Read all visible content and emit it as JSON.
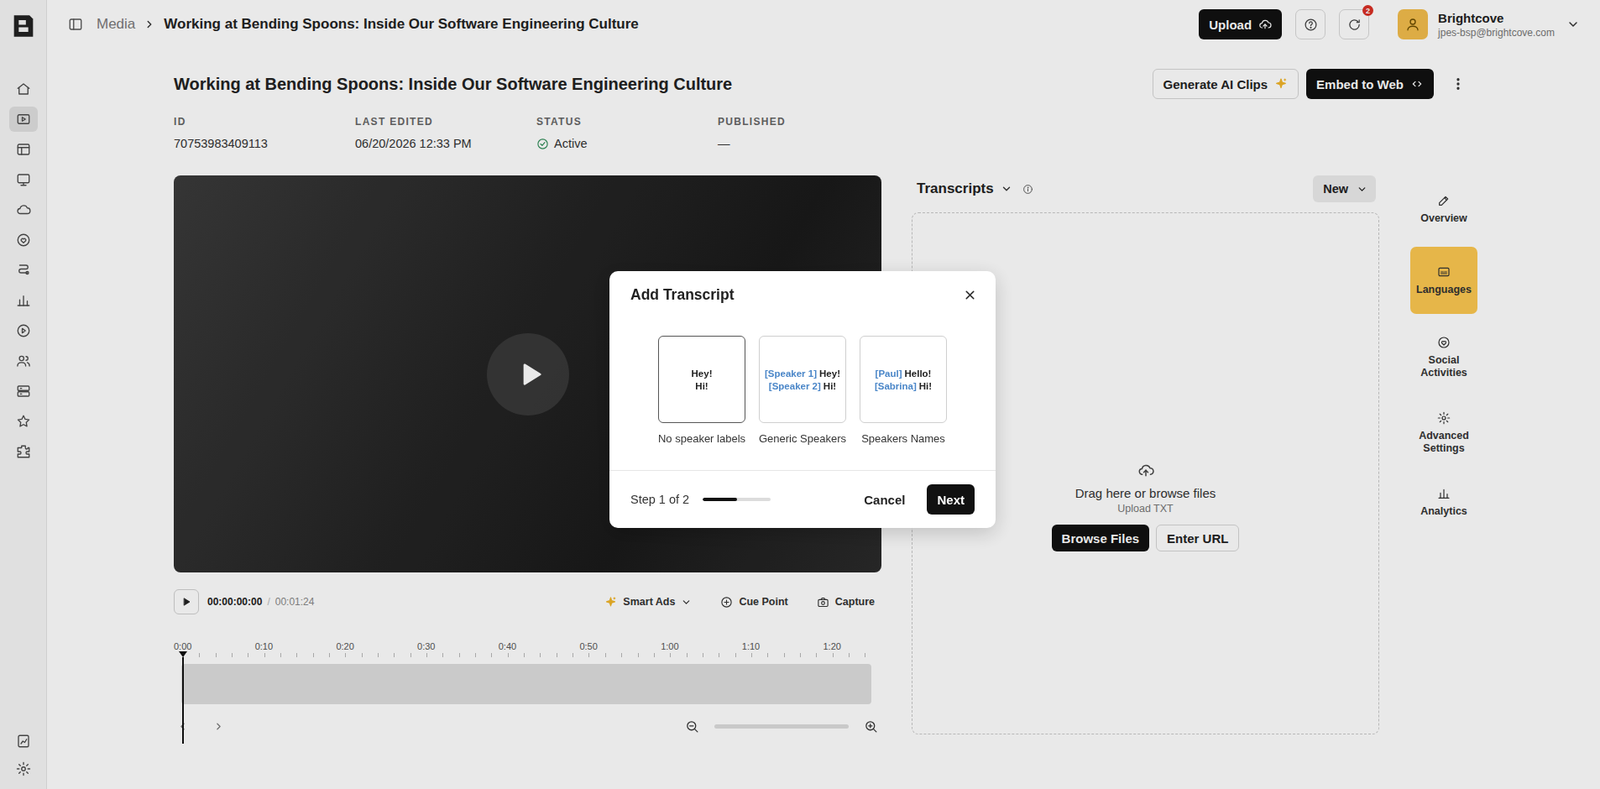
{
  "rail": {
    "items": [
      {
        "selected": false
      },
      {
        "selected": true
      },
      {
        "selected": false
      },
      {
        "selected": false
      },
      {
        "selected": false
      },
      {
        "selected": false
      },
      {
        "selected": false
      },
      {
        "selected": false
      },
      {
        "selected": false
      },
      {
        "selected": false
      },
      {
        "selected": false
      },
      {
        "selected": false
      },
      {
        "selected": false
      }
    ],
    "bottom_items": [
      {
        "selected": false
      },
      {
        "selected": false
      }
    ]
  },
  "topbar": {
    "breadcrumb": [
      "Media",
      "Working at Bending Spoons: Inside Our Software Engineering Culture"
    ],
    "upload": "Upload",
    "notification_count": "2",
    "user": {
      "name": "Brightcove",
      "email": "jpes-bsp@brightcove.com"
    }
  },
  "header": {
    "title": "Working at Bending Spoons: Inside Our Software Engineering Culture",
    "buttons": [
      "Generate AI Clips",
      "Embed to Web"
    ]
  },
  "meta": [
    {
      "label": "ID",
      "value": "70753983409113"
    },
    {
      "label": "LAST EDITED",
      "value": "06/20/2026 12:33 PM"
    },
    {
      "label": "STATUS",
      "value": "Active"
    },
    {
      "label": "PUBLISHED",
      "value": "—"
    }
  ],
  "player": {
    "current": "00:00:00:00",
    "separator": "/",
    "duration": "00:01:24",
    "tools": [
      "Smart Ads",
      "Cue Point",
      "Capture"
    ],
    "ticks": [
      "0:00",
      "0:10",
      "0:20",
      "0:30",
      "0:40",
      "0:50",
      "1:00",
      "1:10",
      "1:20"
    ]
  },
  "transcripts": {
    "title": "Transcripts",
    "new_button": "New",
    "drop_text": "Drag here or browse files",
    "drop_hint": "Upload TXT",
    "buttons": [
      "Browse Files",
      "Enter URL"
    ]
  },
  "right_nav": [
    {
      "label": "Overview",
      "selected": false
    },
    {
      "label": "Languages",
      "selected": true
    },
    {
      "label": "Social Activities",
      "selected": false
    },
    {
      "label": "Advanced Settings",
      "selected": false
    },
    {
      "label": "Analytics",
      "selected": false
    }
  ],
  "modal": {
    "title": "Add Transcript",
    "options": [
      {
        "label": "No speaker labels",
        "selected": true,
        "lines": [
          {
            "text": "Hey!"
          },
          {
            "text": "Hi!"
          }
        ]
      },
      {
        "label": "Generic Speakers",
        "selected": false,
        "lines": [
          {
            "speaker": "[Speaker 1]",
            "text": "Hey!"
          },
          {
            "speaker": "[Speaker 2]",
            "text": "Hi!"
          }
        ]
      },
      {
        "label": "Speakers Names",
        "selected": false,
        "lines": [
          {
            "speaker": "[Paul]",
            "text": "Hello!"
          },
          {
            "speaker": "[Sabrina]",
            "text": "Hi!"
          }
        ]
      }
    ],
    "step": "Step 1 of 2",
    "level": 0.5,
    "buttons": [
      "Cancel",
      "Next"
    ]
  }
}
